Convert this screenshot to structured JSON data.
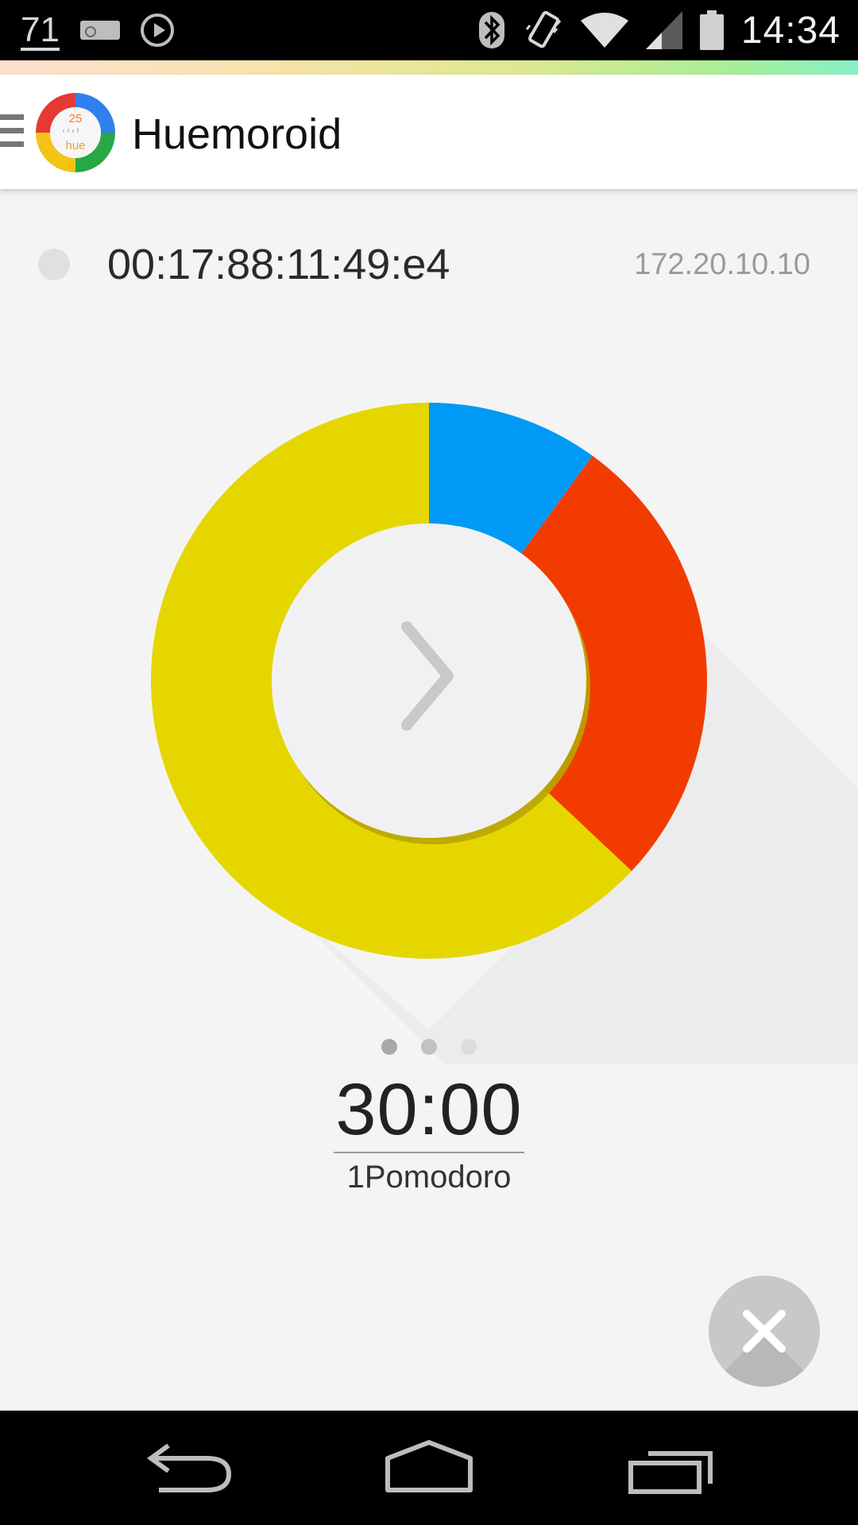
{
  "status_bar": {
    "notification_count": "71",
    "time": "14:34",
    "icons": [
      "sd-card-icon",
      "play-circle-icon",
      "bluetooth-icon",
      "vibrate-icon",
      "wifi-icon",
      "cell-signal-icon",
      "battery-icon"
    ]
  },
  "app_bar": {
    "title": "Huemoroid",
    "logo": {
      "number": "25",
      "word": "hue"
    }
  },
  "bridge": {
    "mac": "00:17:88:11:49:e4",
    "ip": "172.20.10.10"
  },
  "chart_data": {
    "type": "pie",
    "style": "donut",
    "slices": [
      {
        "value": 0.1,
        "color": "#0099f5"
      },
      {
        "value": 0.27,
        "color": "#f23b00"
      },
      {
        "value": 0.63,
        "color": "#e6d600"
      }
    ]
  },
  "center_button": {
    "icon": "chevron-right-icon"
  },
  "pager": {
    "count": 3,
    "active": 0
  },
  "timer": {
    "value": "30:00",
    "label": "1Pomodoro"
  },
  "fab": {
    "icon": "close-icon",
    "color": "#c8c8c8"
  },
  "nav_bar": {
    "buttons": [
      "back-icon",
      "home-icon",
      "recents-icon"
    ]
  }
}
